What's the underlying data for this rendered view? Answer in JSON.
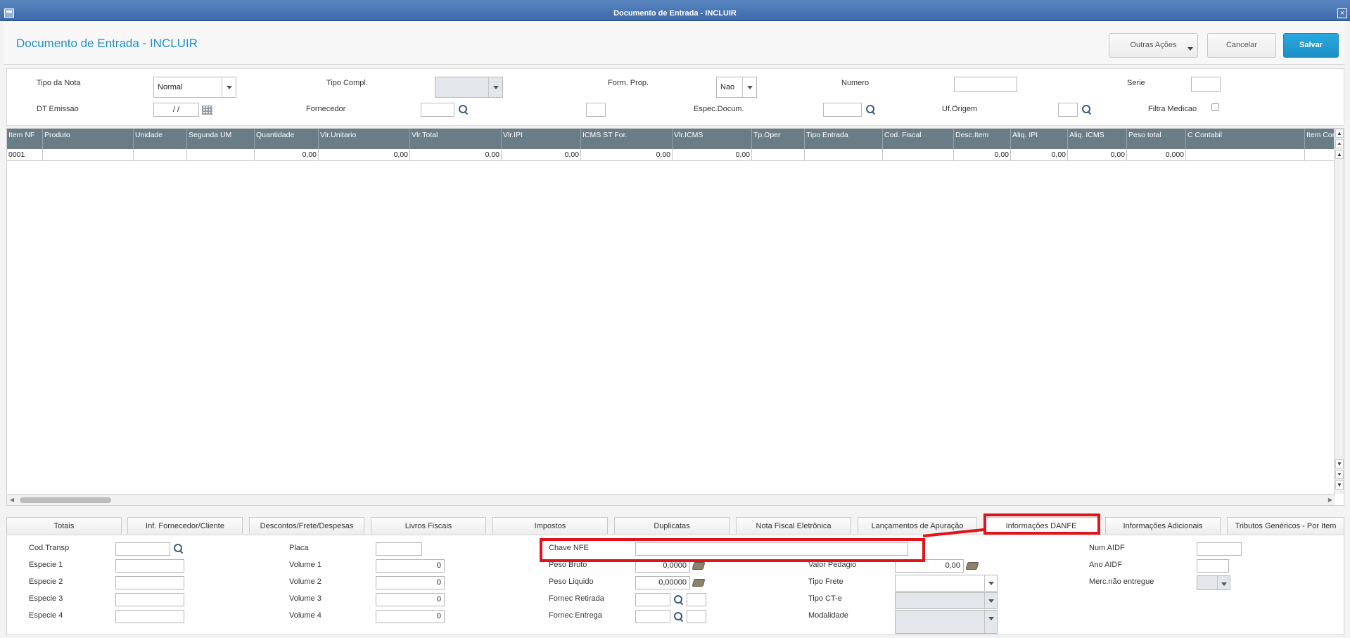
{
  "window": {
    "title": "Documento de Entrada - INCLUIR",
    "close_glyph": "×"
  },
  "header": {
    "title": "Documento de Entrada - INCLUIR",
    "buttons": {
      "outras": "Outras Ações",
      "cancelar": "Cancelar",
      "salvar": "Salvar"
    }
  },
  "form": {
    "tipo_nota": {
      "label": "Tipo da Nota",
      "value": "Normal"
    },
    "tipo_compl": {
      "label": "Tipo Compl.",
      "value": ""
    },
    "form_prop": {
      "label": "Form. Prop.",
      "value": "Nao"
    },
    "numero": {
      "label": "Numero",
      "value": ""
    },
    "serie": {
      "label": "Serie",
      "value": ""
    },
    "dt_emissao": {
      "label": "DT Emissao",
      "value": " /  /"
    },
    "fornecedor": {
      "label": "Fornecedor",
      "value": "",
      "loja": ""
    },
    "espec_docum": {
      "label": "Espec.Docum.",
      "value": ""
    },
    "uf_origem": {
      "label": "Uf.Origem",
      "value": ""
    },
    "filtra_medicao": {
      "label": "Filtra Medicao",
      "checked": false
    }
  },
  "grid": {
    "columns": [
      "Item NF",
      "Produto",
      "Unidade",
      "Segunda UM",
      "Quantidade",
      "Vlr.Unitario",
      "Vlr.Total",
      "Vlr.IPI",
      "ICMS ST For.",
      "Vlr.ICMS",
      "Tp.Oper",
      "Tipo Entrada",
      "Cod. Fiscal",
      "Desc.Item",
      "Aliq. IPI",
      "Aliq. ICMS",
      "Peso total",
      "C Contabil",
      "Item Conta"
    ],
    "rows": [
      [
        "0001",
        "",
        "",
        "",
        "0,00",
        "0,00",
        "0,00",
        "0,00",
        "0,00",
        "0,00",
        "",
        "",
        "",
        "0,00",
        "0,00",
        "0,00",
        "0,000",
        "",
        ""
      ]
    ],
    "scroll_glyphs": {
      "up": "▲",
      "top": "⏶",
      "down": "▼",
      "bottom": "⏷",
      "left": "◀",
      "right": "▶"
    }
  },
  "tabs": [
    {
      "label": "Totais"
    },
    {
      "label": "Inf. Fornecedor/Cliente"
    },
    {
      "label": "Descontos/Frete/Despesas"
    },
    {
      "label": "Livros Fiscais"
    },
    {
      "label": "Impostos"
    },
    {
      "label": "Duplicatas"
    },
    {
      "label": "Nota Fiscal Eletrônica"
    },
    {
      "label": "Lançamentos de Apuração"
    },
    {
      "label": "Informações DANFE",
      "active": true
    },
    {
      "label": "Informações Adicionais"
    },
    {
      "label": "Tributos Genéricos - Por Item"
    }
  ],
  "danfe": {
    "cod_transp": {
      "label": "Cod.Transp",
      "value": ""
    },
    "especie1": {
      "label": "Especie 1",
      "value": ""
    },
    "especie2": {
      "label": "Especie 2",
      "value": ""
    },
    "especie3": {
      "label": "Especie 3",
      "value": ""
    },
    "especie4": {
      "label": "Especie 4",
      "value": ""
    },
    "placa": {
      "label": "Placa",
      "value": ""
    },
    "volume1": {
      "label": "Volume 1",
      "value": "0"
    },
    "volume2": {
      "label": "Volume 2",
      "value": "0"
    },
    "volume3": {
      "label": "Volume 3",
      "value": "0"
    },
    "volume4": {
      "label": "Volume 4",
      "value": "0"
    },
    "chave_nfe": {
      "label": "Chave NFE",
      "value": ""
    },
    "peso_bruto": {
      "label": "Peso Bruto",
      "value": "0,0000"
    },
    "peso_liquido": {
      "label": "Peso Liquido",
      "value": "0,00000"
    },
    "fornec_retirada": {
      "label": "Fornec Retirada",
      "value": "",
      "loja": ""
    },
    "fornec_entrega": {
      "label": "Fornec Entrega",
      "value": "",
      "loja": ""
    },
    "valor_pedagio": {
      "label": "Valor Pedagio",
      "value": "0,00"
    },
    "tipo_frete": {
      "label": "Tipo Frete",
      "value": ""
    },
    "tipo_cte": {
      "label": "Tipo CT-e",
      "value": ""
    },
    "modalidade": {
      "label": "Modalidade",
      "value": ""
    },
    "num_aidf": {
      "label": "Num AIDF",
      "value": ""
    },
    "ano_aidf": {
      "label": "Ano AIDF",
      "value": ""
    },
    "merc_nao_entregue": {
      "label": "Merc.não entregue",
      "value": ""
    }
  },
  "colors": {
    "accent": "#1f8fc7",
    "highlight": "#e0141a",
    "grid_header": "#6a7d87"
  }
}
